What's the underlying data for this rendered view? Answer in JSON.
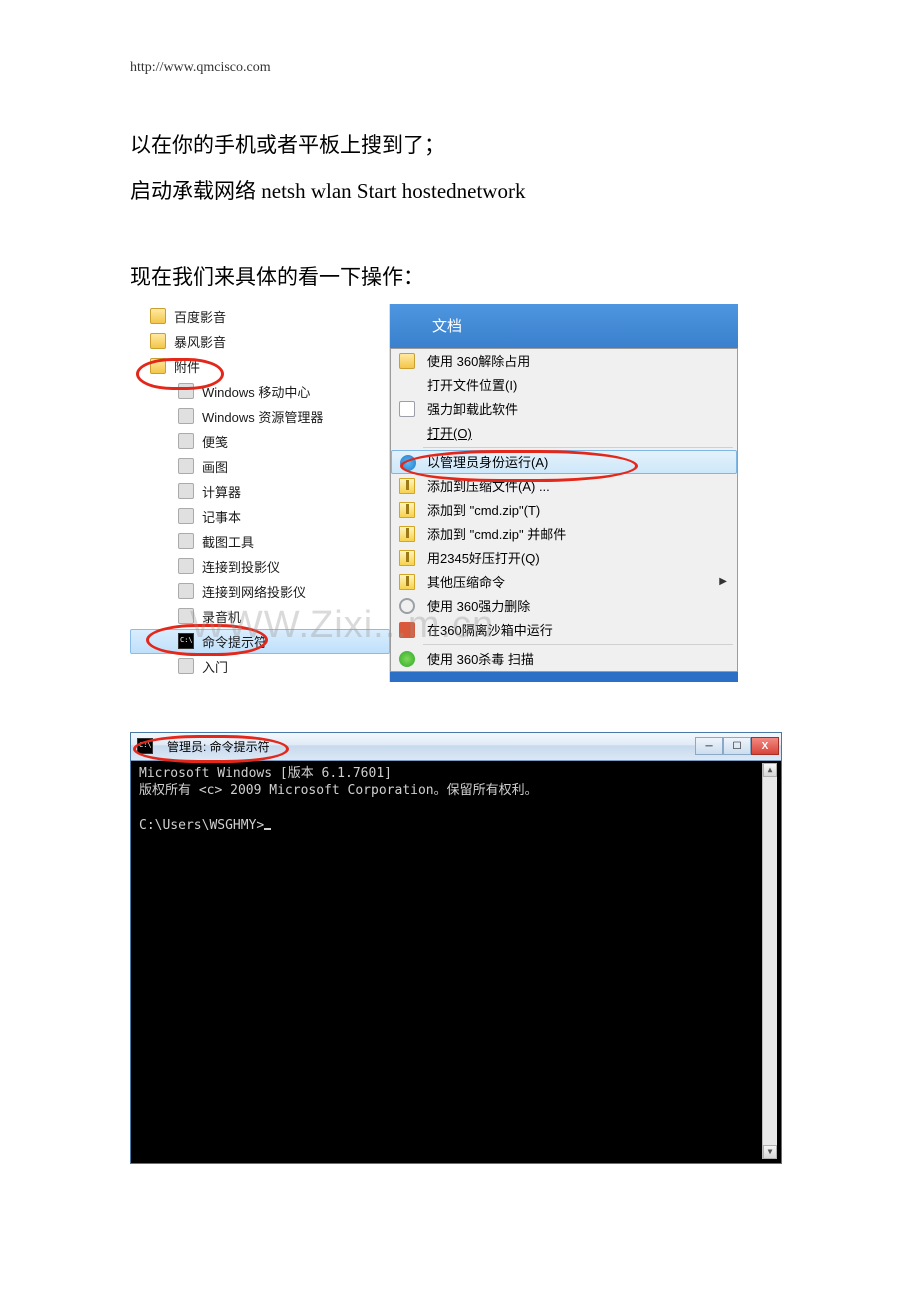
{
  "header_url": "http://www.qmcisco.com",
  "para1": "以在你的手机或者平板上搜到了；",
  "para2": "启动承载网络 netsh wlan Start hostednetwork",
  "para3": "现在我们来具体的看一下操作：",
  "start_menu": {
    "top_folders": [
      "百度影音",
      "暴风影音",
      "附件"
    ],
    "accessories": [
      "Windows 移动中心",
      "Windows 资源管理器",
      "便笺",
      "画图",
      "计算器",
      "记事本",
      "截图工具",
      "连接到投影仪",
      "连接到网络投影仪",
      "录音机",
      "命令提示符",
      "入门"
    ]
  },
  "context_menu": {
    "header": "文档",
    "items": [
      {
        "label": "使用 360解除占用",
        "icon": "folder"
      },
      {
        "label": "打开文件位置(I)",
        "icon": ""
      },
      {
        "label": "强力卸载此软件",
        "icon": "trash"
      },
      {
        "label": "打开(O)",
        "icon": "",
        "underline": true
      },
      {
        "label": "以管理员身份运行(A)",
        "icon": "shield",
        "hl": true
      },
      {
        "label": "添加到压缩文件(A) ...",
        "icon": "zip"
      },
      {
        "label": "添加到 \"cmd.zip\"(T)",
        "icon": "zip"
      },
      {
        "label": "添加到 \"cmd.zip\" 并邮件",
        "icon": "zip"
      },
      {
        "label": "用2345好压打开(Q)",
        "icon": "zip"
      },
      {
        "label": "其他压缩命令",
        "icon": "zip",
        "arrow": true
      },
      {
        "label": "使用 360强力删除",
        "icon": "gear"
      },
      {
        "label": "在360隔离沙箱中运行",
        "icon": "box"
      },
      {
        "label": "使用 360杀毒 扫描",
        "icon": "shield-green"
      }
    ]
  },
  "watermark": "WWW.Zixi...m.cn",
  "cmd": {
    "title": "管理员: 命令提示符",
    "line1": "Microsoft Windows [版本 6.1.7601]",
    "line2": "版权所有 <c> 2009 Microsoft Corporation。保留所有权利。",
    "prompt": "C:\\Users\\WSGHMY>"
  }
}
